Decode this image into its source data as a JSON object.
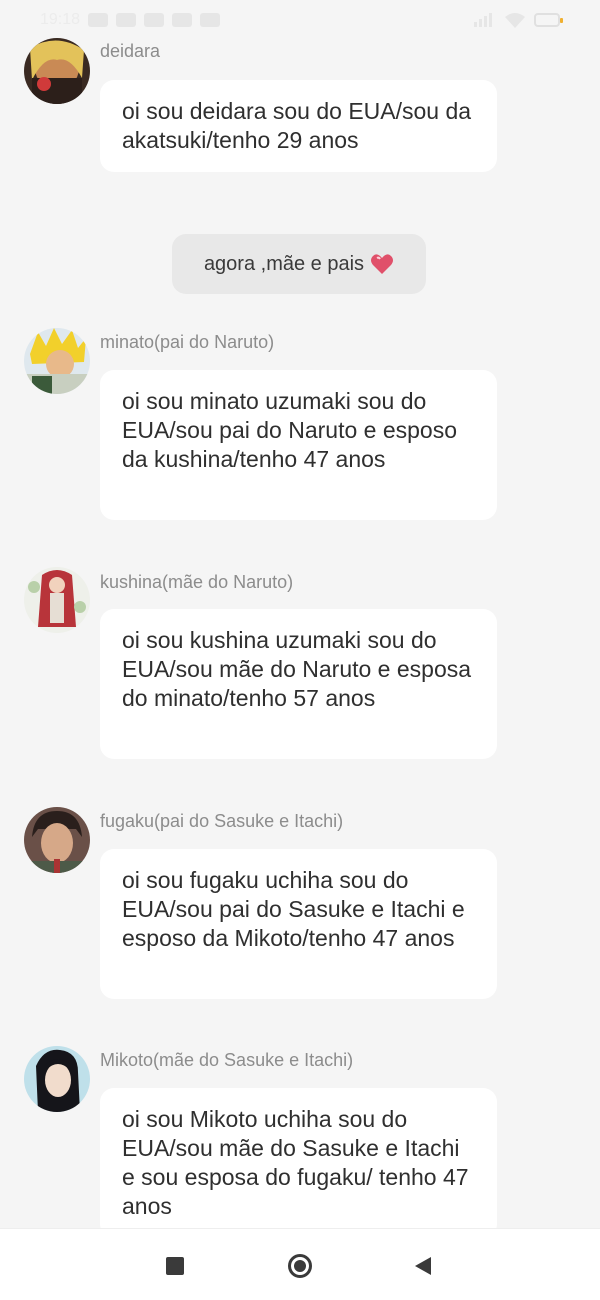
{
  "status_bar": {
    "time": "19:18"
  },
  "notice": {
    "text": "agora ,mãe e pais"
  },
  "messages": [
    {
      "username": "deidara",
      "text": "oi sou deidara sou do EUA/sou da akatsuki/tenho 29 anos"
    },
    {
      "username": "minato(pai do Naruto)",
      "text": "oi sou minato uzumaki sou do EUA/sou pai do Naruto e esposo da kushina/tenho 47 anos"
    },
    {
      "username": "kushina(mãe do Naruto)",
      "text": "oi sou kushina uzumaki sou do EUA/sou mãe do Naruto e esposa do minato/tenho 57 anos"
    },
    {
      "username": "fugaku(pai do Sasuke e Itachi)",
      "text": "oi sou fugaku uchiha sou do EUA/sou pai do Sasuke e Itachi e esposo da Mikoto/tenho 47 anos"
    },
    {
      "username": "Mikoto(mãe do Sasuke e Itachi)",
      "text": "oi sou Mikoto uchiha sou do EUA/sou mãe do Sasuke e Itachi e sou esposa do fugaku/ tenho 47 anos"
    }
  ],
  "colors": {
    "background": "#f5f5f5",
    "bubble": "#ffffff",
    "notice_bg": "#e8e8e8",
    "username": "#8c8c8c",
    "heart": "#e0506a"
  },
  "icons": {
    "nav_recent": "square-icon",
    "nav_home": "circle-home-icon",
    "nav_back": "triangle-back-icon",
    "notice_emoji": "heart-icon"
  }
}
